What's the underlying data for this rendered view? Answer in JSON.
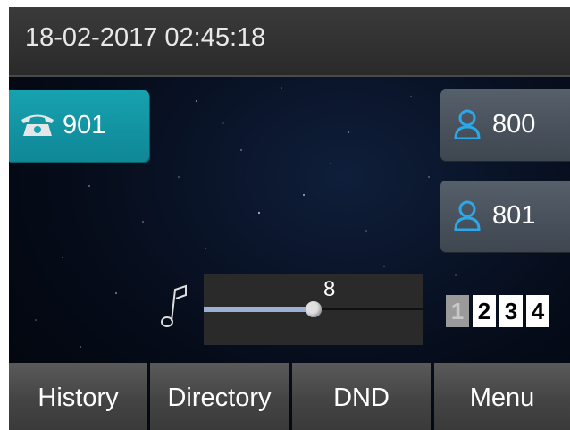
{
  "status_bar": {
    "datetime": "18-02-2017 02:45:18"
  },
  "line_key": {
    "label": "901",
    "icon": "phone-icon",
    "color": "#17a2b0"
  },
  "dss_keys": [
    {
      "label": "800",
      "icon": "person-icon"
    },
    {
      "label": "801",
      "icon": "person-icon"
    }
  ],
  "volume": {
    "value": "8",
    "level": 0.5,
    "icon": "music-note-icon"
  },
  "pages": {
    "items": [
      "1",
      "2",
      "3",
      "4"
    ],
    "active": "1"
  },
  "softkeys": [
    "History",
    "Directory",
    "DND",
    "Menu"
  ],
  "colors": {
    "accent": "#17a2b0",
    "person_icon": "#2aa8e8"
  }
}
